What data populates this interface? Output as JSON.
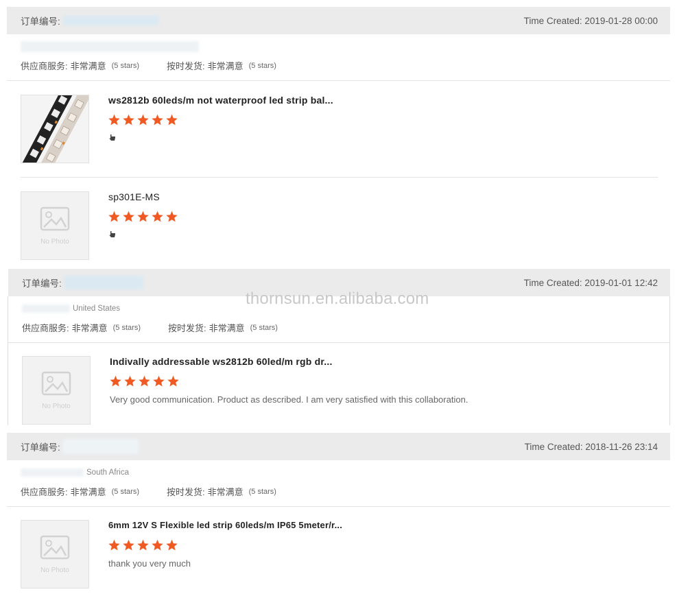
{
  "watermark": "thornsun.en.alibaba.com",
  "labels": {
    "order_no": "订单编号:",
    "time_created_prefix": "Time Created: ",
    "supplier_service": "供应商服务:",
    "on_time_delivery": "按时发货:",
    "very_satisfied": "非常满意",
    "five_stars": "(5 stars)",
    "no_photo": "No Photo"
  },
  "orders": [
    {
      "time_created": "2019-01-28 00:00",
      "country": "",
      "items": [
        {
          "title": "ws2812b 60leds/m not waterproof led strip bal...",
          "rating": 5,
          "feedback": "",
          "has_photo": true
        },
        {
          "title": "sp301E-MS",
          "rating": 5,
          "feedback": "",
          "has_photo": false
        }
      ]
    },
    {
      "time_created": "2019-01-01 12:42",
      "country": "United States",
      "items": [
        {
          "title": "Indivally addressable ws2812b 60led/m rgb dr...",
          "rating": 5,
          "feedback": "Very good communication. Product as described. I am very satisfied with this collaboration.",
          "has_photo": false
        }
      ]
    },
    {
      "time_created": "2018-11-26 23:14",
      "country": "South Africa",
      "items": [
        {
          "title": "6mm 12V S Flexible led strip 60leds/m IP65 5meter/r...",
          "rating": 5,
          "feedback": "thank you very much",
          "has_photo": false
        }
      ]
    }
  ],
  "colors": {
    "star": "#f05a22",
    "header_bg": "#ebebeb"
  }
}
